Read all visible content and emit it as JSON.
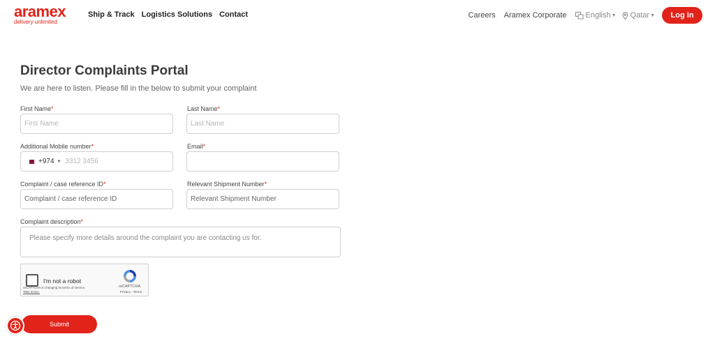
{
  "brand": {
    "name": "aramex",
    "tagline": "delivery unlimited",
    "color": "#e2231a"
  },
  "nav": {
    "items": [
      "Ship & Track",
      "Logistics Solutions",
      "Contact"
    ]
  },
  "topbar": {
    "careers": "Careers",
    "corporate": "Aramex Corporate",
    "language": "English",
    "country": "Qatar",
    "login": "Log in"
  },
  "page": {
    "title": "Director Complaints Portal",
    "subtitle": "We are here to listen. Please fill in the below to submit your complaint"
  },
  "form": {
    "first_name": {
      "label": "First Name",
      "placeholder": "First Name"
    },
    "last_name": {
      "label": "Last Name",
      "placeholder": "Last Name"
    },
    "mobile": {
      "label": "Additional Mobile number",
      "code": "+974",
      "placeholder": "3312 3456"
    },
    "email": {
      "label": "Email",
      "placeholder": ""
    },
    "case_ref": {
      "label": "Complaint / case reference ID",
      "placeholder": "Complaint / case reference ID"
    },
    "shipment": {
      "label": "Relevant Shipment Number",
      "placeholder": "Relevant Shipment Number"
    },
    "description": {
      "label": "Complaint description",
      "placeholder": "Please specify more details around the complaint you are contacting us for."
    },
    "required_mark": "*",
    "submit": "Submit"
  },
  "recaptcha": {
    "label": "I'm not a robot",
    "notice": "reCAPTCHA is changing its terms of service.",
    "action": "Take action.",
    "brand": "reCAPTCHA",
    "links": "Privacy - Terms"
  },
  "icons": {
    "language": "language-icon",
    "location": "location-pin-icon",
    "recaptcha": "recaptcha-logo-icon",
    "accessibility": "accessibility-icon"
  }
}
